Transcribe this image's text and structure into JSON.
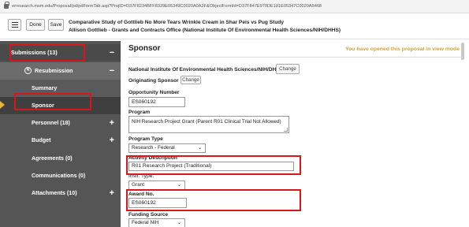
{
  "browser": {
    "url": "erresearch.msm.edu/Proposal/pd/pdFormTab.asp?ProjID=D37F8234BFF8329E05349C0020A0A2F&ObjectFormId=D37F847E970DE181E05347C0020A5468"
  },
  "header": {
    "done_label": "Done",
    "save_label": "Save",
    "title_line1": "Comparative Study of Gottlieb No More Tears Wrinkle Cream in Shar Peis vs Pug Study",
    "title_line2": "Allison Gottlieb - Grants and Contracts Office (National Institute Of Environmental Health Sciences/NIH/DHHS)"
  },
  "sidebar": {
    "submissions_label": "Submissions (13)",
    "submissions_mark": "−",
    "resubmission_label": "Resubmission",
    "resubmission_icon_text": "N",
    "resubmission_mark": "−",
    "items": [
      {
        "label": "Summary"
      },
      {
        "label": "Sponsor"
      },
      {
        "label": "Personnel (18)",
        "mark": "+"
      },
      {
        "label": "Budget",
        "mark": "+"
      },
      {
        "label": "Agreements (0)"
      },
      {
        "label": "Communications (0)"
      },
      {
        "label": "Attachments (10)",
        "mark": "+"
      }
    ]
  },
  "main": {
    "title": "Sponsor",
    "notice": "You have opened this proposal in view mode",
    "sponsor_name": "National Institute Of Environmental Health Sciences/NIH/DHHS",
    "change_label": "Change",
    "originating_sponsor_label": "Originating Sponsor",
    "originating_change_label": "Change",
    "opportunity_number_label": "Opportunity Number",
    "opportunity_number_value": "ES060192",
    "program_label": "Program",
    "program_value": "NIH Research Project Grant (Parent R01 Clinical Trial Not Allowed)",
    "program_type_label": "Program Type",
    "program_type_value": "Research - Federal",
    "activity_description_label": "Activity Description",
    "activity_description_value": "R01 Research Project (Traditional)",
    "instr_type_label": "Instr. Type:",
    "instr_type_value": "Grant",
    "award_no_label": "Award No.",
    "award_no_value": "ES060192",
    "funding_source_label": "Funding Source",
    "funding_source_value": "Federal NIH"
  }
}
